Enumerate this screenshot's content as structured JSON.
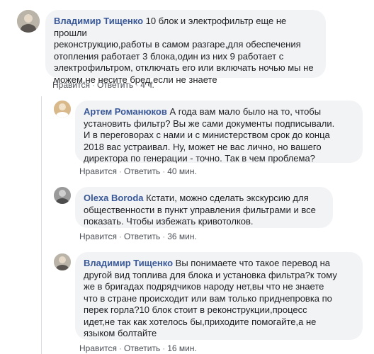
{
  "comments": [
    {
      "author": "Владимир Тищенко",
      "text": "10 блок и электрофильтр еще не прошли\nреконструкцию,работы в самом разгаре,для обеспечения\nотопления работает 3 блока,один из них 9 работает с\nэлектрофильтром, отключать его или включать ночью мы не\nможем,не несите бред,если не знаете",
      "like": "Нравится",
      "reply": "Ответить",
      "time": "4 ч."
    },
    {
      "author": "Артем Романюков",
      "text": "А года вам мало было на то, чтобы\nустановить фильтр? Вы же сами документы подписывали.\nИ в переговорах с нами и с министерством срок до конца\n2018 вас устраивал. Ну, может не вас лично, но вашего\nдиректора по генерации - точно. Так в чем проблема?",
      "like": "Нравится",
      "reply": "Ответить",
      "time": "40 мин."
    },
    {
      "author": "Olexa Boroda",
      "text": "Кстати, можно сделать экскурсию для\nобщественности в пункт управления фильтрами и все\nпоказать. Чтобы избежать кривотолков.",
      "like": "Нравится",
      "reply": "Ответить",
      "time": "36 мин."
    },
    {
      "author": "Владимир Тищенко",
      "text": "Вы понимаете что такое перевод на\nдругой вид топлива для блока и установка фильтра?к тому\nже в бригадах подрядчиков народу нет,вы что не знаете\nчто в стране происходит или вам только приднепровка по\nперек горла?10 блок стоит в реконструкции,процесс\nидет,не так как хотелось бы,приходите помогайте,а не\nязыком болтайте",
      "like": "Нравится",
      "reply": "Ответить",
      "time": "16 мин."
    }
  ],
  "separator": "·",
  "colors": {
    "author": "#385898",
    "bubble": "#f2f3f5",
    "meta": "#90949c"
  }
}
